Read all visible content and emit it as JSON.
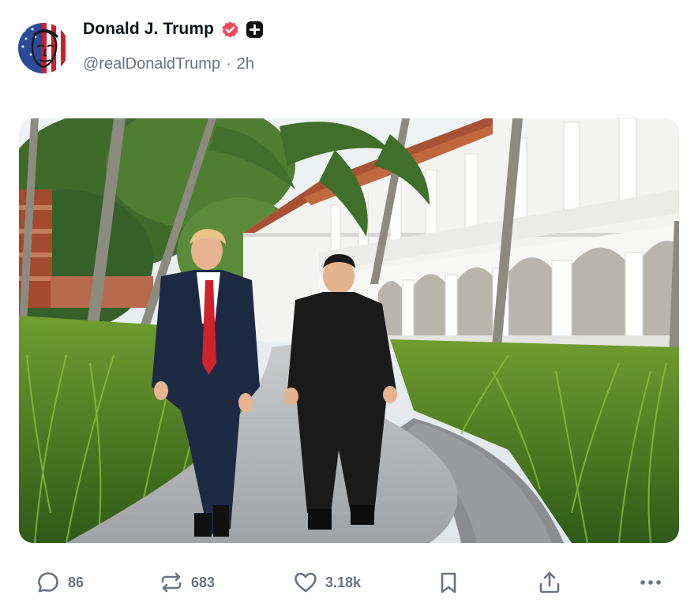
{
  "post": {
    "author": {
      "display_name": "Donald J. Trump",
      "handle": "@realDonaldTrump",
      "separator": "·",
      "time_ago": "2h",
      "verified_badge_icon": "verified-badge-icon",
      "plus_badge_icon": "plus-badge-icon",
      "avatar_icon": "avatar-flag-portrait"
    },
    "media": {
      "type": "photo"
    },
    "actions": {
      "reply": {
        "icon": "reply-icon",
        "count": "86"
      },
      "repost": {
        "icon": "repost-icon",
        "count": "683"
      },
      "like": {
        "icon": "heart-icon",
        "count": "3.18k"
      },
      "bookmark": {
        "icon": "bookmark-icon"
      },
      "share": {
        "icon": "share-icon"
      },
      "more": {
        "icon": "more-icon"
      }
    }
  },
  "colors": {
    "text_primary": "#0f1419",
    "text_secondary": "#6b7280",
    "verified_badge": "#f04a5b",
    "plus_badge": "#111111"
  }
}
